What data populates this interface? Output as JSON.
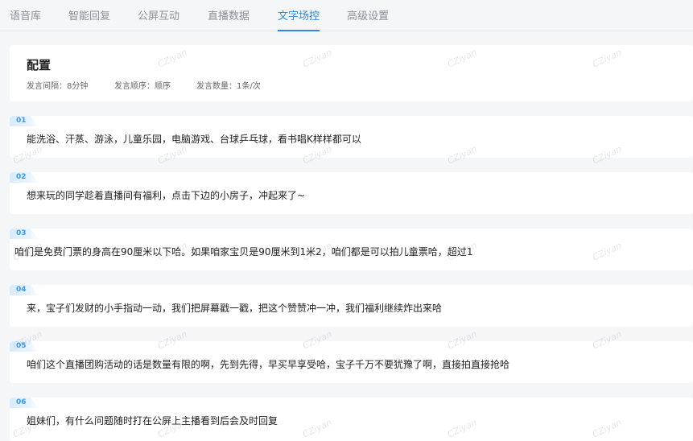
{
  "tabs": [
    {
      "label": "语音库",
      "active": false
    },
    {
      "label": "智能回复",
      "active": false
    },
    {
      "label": "公屏互动",
      "active": false
    },
    {
      "label": "直播数据",
      "active": false
    },
    {
      "label": "文字场控",
      "active": true
    },
    {
      "label": "高级设置",
      "active": false
    }
  ],
  "config": {
    "title": "配置",
    "interval": "发言间隔：8分钟",
    "order": "发言顺序：顺序",
    "count": "发言数量：1条/次"
  },
  "messages": [
    {
      "num": "01",
      "text": "能洗浴、汗蒸、游泳，儿童乐园，电脑游戏、台球乒乓球，看书唱K样样都可以"
    },
    {
      "num": "02",
      "text": "想来玩的同学趁着直播间有福利，点击下边的小房子，冲起来了~"
    },
    {
      "num": "03",
      "text": "咱们是免费门票的身高在90厘米以下哈。如果咱家宝贝是90厘米到1米2，咱们都是可以拍儿童票哈，超过1"
    },
    {
      "num": "04",
      "text": "来，宝子们发财的小手指动一动，我们把屏幕戳一戳，把这个赞赞冲一冲，我们福利继续炸出来哈"
    },
    {
      "num": "05",
      "text": "咱们这个直播团购活动的话是数量有限的啊，先到先得，早买早享受哈，宝子千万不要犹豫了啊，直接拍直接抢哈"
    },
    {
      "num": "06",
      "text": "姐妹们，有什么问题随时打在公屏上主播看到后会及时回复"
    }
  ],
  "watermark": "CZiyan",
  "colors": {
    "accent": "#2b8ae8",
    "badge": "#d7ebfb"
  }
}
